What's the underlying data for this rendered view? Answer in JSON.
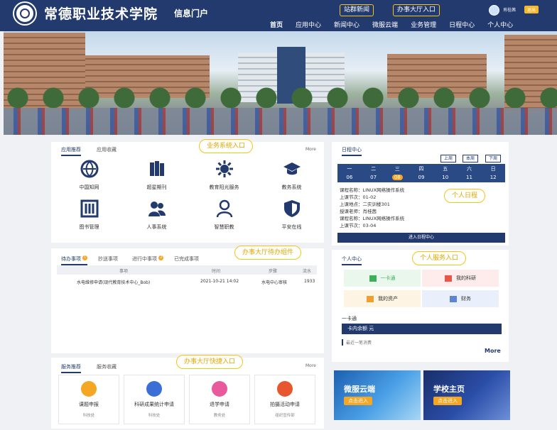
{
  "colors": {
    "primary": "#223a6e",
    "accent": "#f5c518",
    "orange": "#f5a623"
  },
  "header": {
    "school_name": "常德职业技术学院",
    "portal_name": "信息门户",
    "link_news": "站群新闻",
    "link_hall": "办事大厅入口",
    "user_name": "肖桂茜",
    "logout": "退出"
  },
  "nav": [
    "首页",
    "应用中心",
    "新闻中心",
    "微服云端",
    "业务管理",
    "日程中心",
    "个人中心"
  ],
  "apps": {
    "tabs": [
      "应用推荐",
      "应用收藏"
    ],
    "more": "More",
    "callout": "业务系统入口",
    "items": [
      {
        "label": "中国知网",
        "icon": "globe-icon"
      },
      {
        "label": "超星期刊",
        "icon": "books-icon"
      },
      {
        "label": "教育阳光服务",
        "icon": "sun-icon"
      },
      {
        "label": "教务系统",
        "icon": "graduation-cap-icon"
      },
      {
        "label": "图书管理",
        "icon": "library-icon"
      },
      {
        "label": "人事系统",
        "icon": "users-icon"
      },
      {
        "label": "智慧职教",
        "icon": "teacher-icon"
      },
      {
        "label": "平安在线",
        "icon": "shield-icon"
      }
    ]
  },
  "todo": {
    "tabs": [
      "待办事项",
      "抄送事项",
      "进行中事项",
      "已完成事项"
    ],
    "badge_pending": "1",
    "badge_progress": "2",
    "callout": "办事大厅待办组件",
    "columns": [
      "事项",
      "时间",
      "步骤",
      "流水"
    ],
    "rows": [
      {
        "item": "水电维修申请(现代教育技术中心_Bob)",
        "time": "2021-10-21 14:02",
        "step": "水电中心审核",
        "serial": "1933"
      }
    ]
  },
  "services": {
    "tabs": [
      "服务推荐",
      "服务收藏"
    ],
    "more": "More",
    "callout": "办事大厅快捷入口",
    "items": [
      {
        "label": "课题申报",
        "dept": "科技处",
        "icon": "document-icon",
        "color": "#f5a623"
      },
      {
        "label": "科研成果统计申请",
        "dept": "科技处",
        "icon": "microscope-icon",
        "color": "#3b6fd6"
      },
      {
        "label": "退学申请",
        "dept": "教务处",
        "icon": "student-icon",
        "color": "#e85a9b"
      },
      {
        "label": "拍摄活动申请",
        "dept": "组织宣传部",
        "icon": "camera-icon",
        "color": "#e8562f"
      }
    ]
  },
  "calendar": {
    "tab": "日程中心",
    "buttons": [
      "上周",
      "本周",
      "下周"
    ],
    "callout": "个人日程",
    "days": [
      {
        "wd": "一",
        "dn": "06"
      },
      {
        "wd": "二",
        "dn": "07"
      },
      {
        "wd": "三",
        "dn": "08"
      },
      {
        "wd": "四",
        "dn": "09"
      },
      {
        "wd": "五",
        "dn": "10"
      },
      {
        "wd": "六",
        "dn": "11"
      },
      {
        "wd": "日",
        "dn": "12"
      }
    ],
    "schedule": [
      "课程名称：LINUX网络操作系统",
      "上课节次：01-02",
      "上课地点：二实训楼301",
      "授课老师：肖桂茜",
      "课程名称：LINUX网络操作系统",
      "上课节次：03-04"
    ],
    "enter": "进入日程中心"
  },
  "personal": {
    "tab": "个人中心",
    "callout": "个人服务入口",
    "items": [
      {
        "label": "一卡通",
        "icon": "card-icon",
        "bg": "#eaf7ec",
        "color": "#3fae5a"
      },
      {
        "label": "我的科研",
        "icon": "research-icon",
        "bg": "#fdeceb",
        "color": "#e8564a"
      },
      {
        "label": "我的资产",
        "icon": "assets-icon",
        "bg": "#fdf4e3",
        "color": "#f0a030"
      },
      {
        "label": "财务",
        "icon": "finance-icon",
        "bg": "#eaf0fb",
        "color": "#5b86d6"
      }
    ],
    "card_title": "一卡通",
    "balance": "卡内余额 元",
    "recent": "最近一笔消费",
    "more": "More"
  },
  "promos": [
    {
      "title": "微服云端",
      "button": "点击进入"
    },
    {
      "title": "学校主页",
      "button": "点击进入"
    }
  ]
}
